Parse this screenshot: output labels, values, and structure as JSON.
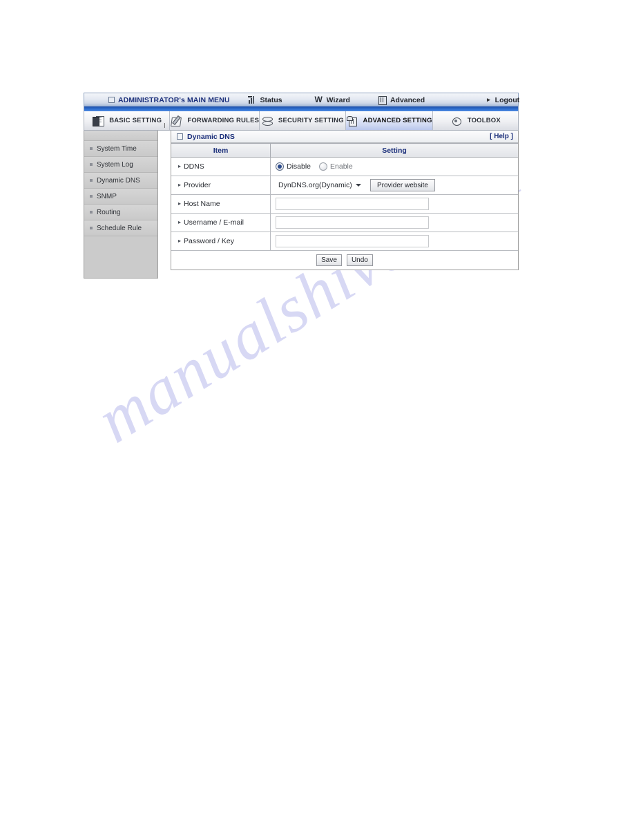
{
  "watermark": {
    "text": "manualshive.com"
  },
  "topbar": {
    "admin_menu": "ADMINISTRATOR's MAIN MENU",
    "items": [
      {
        "label": "Status",
        "icon": "status-bars-icon"
      },
      {
        "label": "Wizard",
        "icon": "wizard-wand-icon"
      },
      {
        "label": "Advanced",
        "icon": "advanced-cabinet-icon"
      },
      {
        "label": "Logout",
        "icon": "arrow-right-icon"
      }
    ]
  },
  "tabs": [
    {
      "label": "BASIC SETTING",
      "icon": "documents-icon",
      "active": false
    },
    {
      "label": "FORWARDING RULES",
      "icon": "pencil-page-icon",
      "active": false
    },
    {
      "label": "SECURITY SETTING",
      "icon": "shield-stack-icon",
      "active": false
    },
    {
      "label": "ADVANCED SETTING",
      "icon": "cube-icon",
      "active": true
    },
    {
      "label": "TOOLBOX",
      "icon": "toolbox-gear-icon",
      "active": false
    }
  ],
  "sidebar": {
    "items": [
      {
        "label": "System Time"
      },
      {
        "label": "System Log"
      },
      {
        "label": "Dynamic DNS"
      },
      {
        "label": "SNMP"
      },
      {
        "label": "Routing"
      },
      {
        "label": "Schedule Rule"
      }
    ]
  },
  "panel": {
    "title": "Dynamic DNS",
    "help": "[ Help ]",
    "columns": {
      "item": "Item",
      "setting": "Setting"
    },
    "rows": {
      "ddns": {
        "label": "DDNS",
        "options": [
          {
            "label": "Disable",
            "selected": true
          },
          {
            "label": "Enable",
            "selected": false
          }
        ]
      },
      "provider": {
        "label": "Provider",
        "selected": "DynDNS.org(Dynamic)",
        "button": "Provider website"
      },
      "host_name": {
        "label": "Host Name",
        "value": "",
        "placeholder": ""
      },
      "username": {
        "label": "Username / E-mail",
        "value": "",
        "placeholder": ""
      },
      "password": {
        "label": "Password / Key",
        "value": "",
        "placeholder": ""
      }
    },
    "footer": {
      "save": "Save",
      "undo": "Undo"
    }
  }
}
